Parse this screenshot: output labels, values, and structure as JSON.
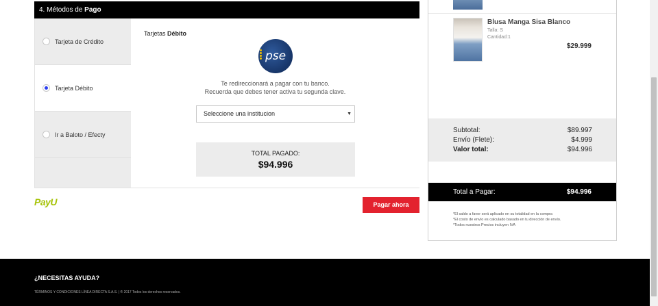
{
  "payment": {
    "header_prefix": "4. Métodos de ",
    "header_bold": "Pago",
    "methods": [
      {
        "label": "Tarjeta de Crédito",
        "selected": false
      },
      {
        "label": "Tarjeta Débito",
        "selected": true
      },
      {
        "label": "Ir a Baloto / Efecty",
        "selected": false
      }
    ],
    "section_prefix": "Tarjetas ",
    "section_bold": "Débito",
    "pse_logo_text": "pse",
    "redirect_line1": "Te redireccionará a pagar con tu banco.",
    "redirect_line2": "Recuerda que debes tener activa tu segunda clave.",
    "institution_select": "Seleccione una institucion",
    "total_label": "TOTAL PAGADO:",
    "total_value": "$94.996",
    "payu_logo_text": "PayU",
    "pay_button": "Pagar ahora"
  },
  "summary": {
    "product": {
      "name": "Blusa Manga Sisa Blanco",
      "size": "Talla: S",
      "quantity": "Cantidad:1",
      "price": "$29.999"
    },
    "subtotal_label": "Subtotal:",
    "subtotal_value": "$89.997",
    "shipping_label": "Envío (Flete):",
    "shipping_value": "$4.999",
    "total_label": "Valor total:",
    "total_value": "$94.996",
    "to_pay_label": "Total a Pagar:",
    "to_pay_value": "$94.996",
    "notes": [
      "*El saldo a favor será aplicado en su totalidad en la compra",
      "*El costo de envío es calculado basado en tu dirección de envío.",
      "*Todos nuestros Precios incluyen IVA"
    ]
  },
  "footer": {
    "help": "¿NECESITAS AYUDA?",
    "legal": "TÉRMINOS Y CONDICIONES LÍNEA DIRECTA S.A.S.  |  ® 2017 Todos los derechos reservados."
  },
  "colors": {
    "accent": "#e3222e",
    "radio_checked": "#2b3ef0",
    "payu_green": "#a6c307",
    "pse_blue": "#173568"
  }
}
